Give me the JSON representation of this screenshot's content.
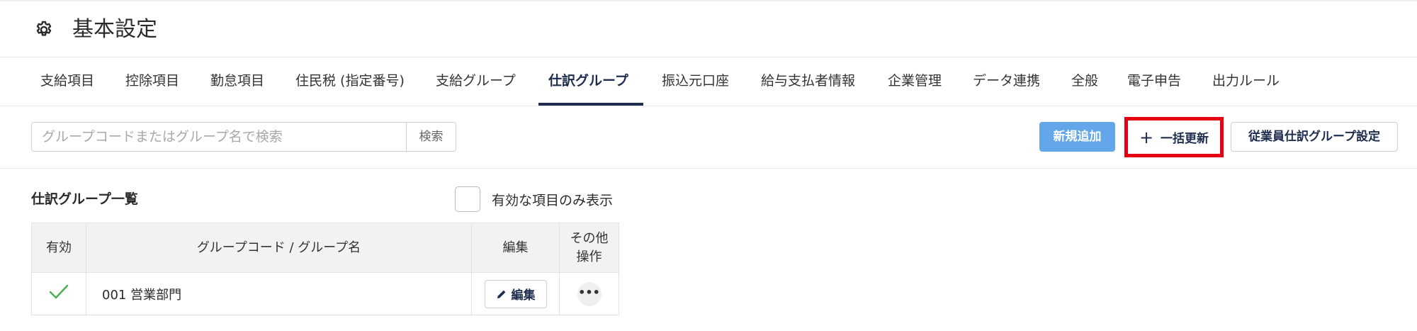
{
  "header": {
    "title": "基本設定",
    "icon": "gear-icon"
  },
  "tabs": [
    {
      "label": "支給項目"
    },
    {
      "label": "控除項目"
    },
    {
      "label": "勤怠項目"
    },
    {
      "label": "住民税 (指定番号)"
    },
    {
      "label": "支給グループ"
    },
    {
      "label": "仕訳グループ",
      "active": true
    },
    {
      "label": "振込元口座"
    },
    {
      "label": "給与支払者情報"
    },
    {
      "label": "企業管理"
    },
    {
      "label": "データ連携"
    },
    {
      "label": "全般"
    },
    {
      "label": "電子申告"
    },
    {
      "label": "出力ルール"
    }
  ],
  "toolbar": {
    "search_placeholder": "グループコードまたはグループ名で検索",
    "search_value": "",
    "search_button": "検索",
    "new_button": "新規追加",
    "bulk_update_button": "一括更新",
    "employee_setting_button": "従業員仕訳グループ設定",
    "highlight_color": "#e60012",
    "accent_color": "#63a7ea"
  },
  "list": {
    "title": "仕訳グループ一覧",
    "filter_label": "有効な項目のみ表示",
    "filter_checked": false,
    "columns": {
      "enabled": "有効",
      "name": "グループコード / グループ名",
      "edit": "編集",
      "other_line1": "その他",
      "other_line2": "操作"
    },
    "rows": [
      {
        "enabled": true,
        "name": "001 営業部門",
        "edit_label": "編集",
        "more": "•••"
      }
    ]
  }
}
